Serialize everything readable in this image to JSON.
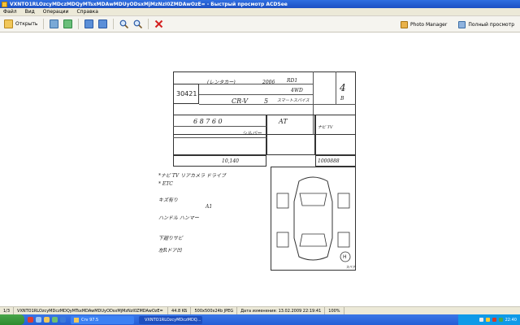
{
  "window": {
    "title": "VXNTO1RLOzcyMDczMDQyMTsxMDAwMDUyODsxMjMzNzI0ZMDAwOzE= - Быстрый просмотр ACDSee"
  },
  "menu": {
    "items": [
      "Файл",
      "Вид",
      "Операции",
      "Справка"
    ]
  },
  "toolbar": {
    "open_label": "Открыть",
    "photo_manager_label": "Photo Manager",
    "fullscreen_label": "Полный просмотр"
  },
  "sheet": {
    "lot_number": "30421",
    "rental_label": "(レンタカー)",
    "year": "2006",
    "model_code": "RD1",
    "drive": "4WD",
    "model": "CR-V",
    "doors": "5",
    "grade": "スマートスパイス",
    "score": "4",
    "interior": "B",
    "mileage": "6 8 7 6 0",
    "transmission": "AT",
    "color": "シルバー",
    "recycle": "10,140",
    "chassis": "1000888",
    "notes_1": "*ナビ TV リアカメラ ドライブ",
    "notes_2": "* ETC",
    "inspector_notes": [
      "キズ有り",
      "A1",
      "ハンドル ハンマー",
      "下廻りサビ",
      "左Rドア凹"
    ],
    "diagram_label": "H",
    "spare_label": "スペア"
  },
  "statusbar": {
    "index": "1/3",
    "filename": "VXNTO1RLOzcyMDczMDQyMTsxMDAwMDUyODsxMjMzNzI0ZMDAwOzE=",
    "filesize": "44.8 KБ",
    "dims": "500x500x24b JPEG",
    "modified": "Дата изменения: 13.02.2009 22:19:41",
    "zoom": "100%"
  },
  "taskbar": {
    "task_1": "Crv 97.5",
    "task_2": "VXNTO1RLOzcyMDczMDQ...",
    "clock": "22:40"
  }
}
